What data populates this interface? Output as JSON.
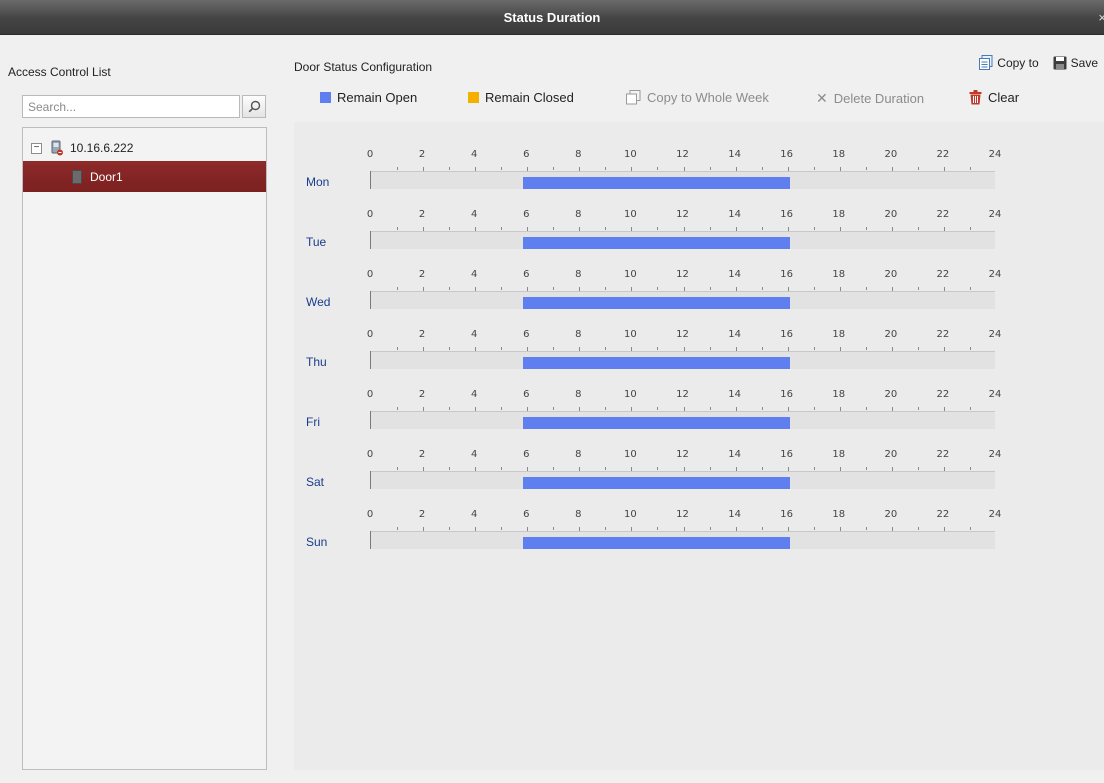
{
  "window": {
    "title": "Status Duration",
    "close_glyph": "×"
  },
  "left": {
    "title": "Access Control List",
    "search_placeholder": "Search...",
    "tree": {
      "device": {
        "label": "10.16.6.222",
        "expander": "−",
        "icon": "device-icon"
      },
      "children": [
        {
          "label": "Door1",
          "icon": "door-icon",
          "selected": true
        }
      ]
    }
  },
  "main": {
    "title": "Door Status Configuration",
    "actions": {
      "copy_to": "Copy to",
      "save": "Save"
    },
    "toolbar": {
      "remain_open": "Remain Open",
      "remain_closed": "Remain Closed",
      "copy_week": "Copy to Whole Week",
      "delete_duration": "Delete Duration",
      "clear": "Clear"
    }
  },
  "colors": {
    "remain_open": "#5f7ff0",
    "remain_closed": "#f4b000",
    "selection": "#8a2727"
  },
  "schedule": {
    "hours": [
      "0",
      "2",
      "4",
      "6",
      "8",
      "10",
      "12",
      "14",
      "16",
      "18",
      "20",
      "22",
      "24"
    ],
    "days": [
      {
        "day": "Mon",
        "segments": [
          {
            "status": "remain_open",
            "start": 5.85,
            "end": 16.1
          }
        ]
      },
      {
        "day": "Tue",
        "segments": [
          {
            "status": "remain_open",
            "start": 5.85,
            "end": 16.1
          }
        ]
      },
      {
        "day": "Wed",
        "segments": [
          {
            "status": "remain_open",
            "start": 5.85,
            "end": 16.1
          }
        ]
      },
      {
        "day": "Thu",
        "segments": [
          {
            "status": "remain_open",
            "start": 5.85,
            "end": 16.1
          }
        ]
      },
      {
        "day": "Fri",
        "segments": [
          {
            "status": "remain_open",
            "start": 5.85,
            "end": 16.1
          }
        ]
      },
      {
        "day": "Sat",
        "segments": [
          {
            "status": "remain_open",
            "start": 5.85,
            "end": 16.1
          }
        ]
      },
      {
        "day": "Sun",
        "segments": [
          {
            "status": "remain_open",
            "start": 5.85,
            "end": 16.1
          }
        ]
      }
    ]
  }
}
